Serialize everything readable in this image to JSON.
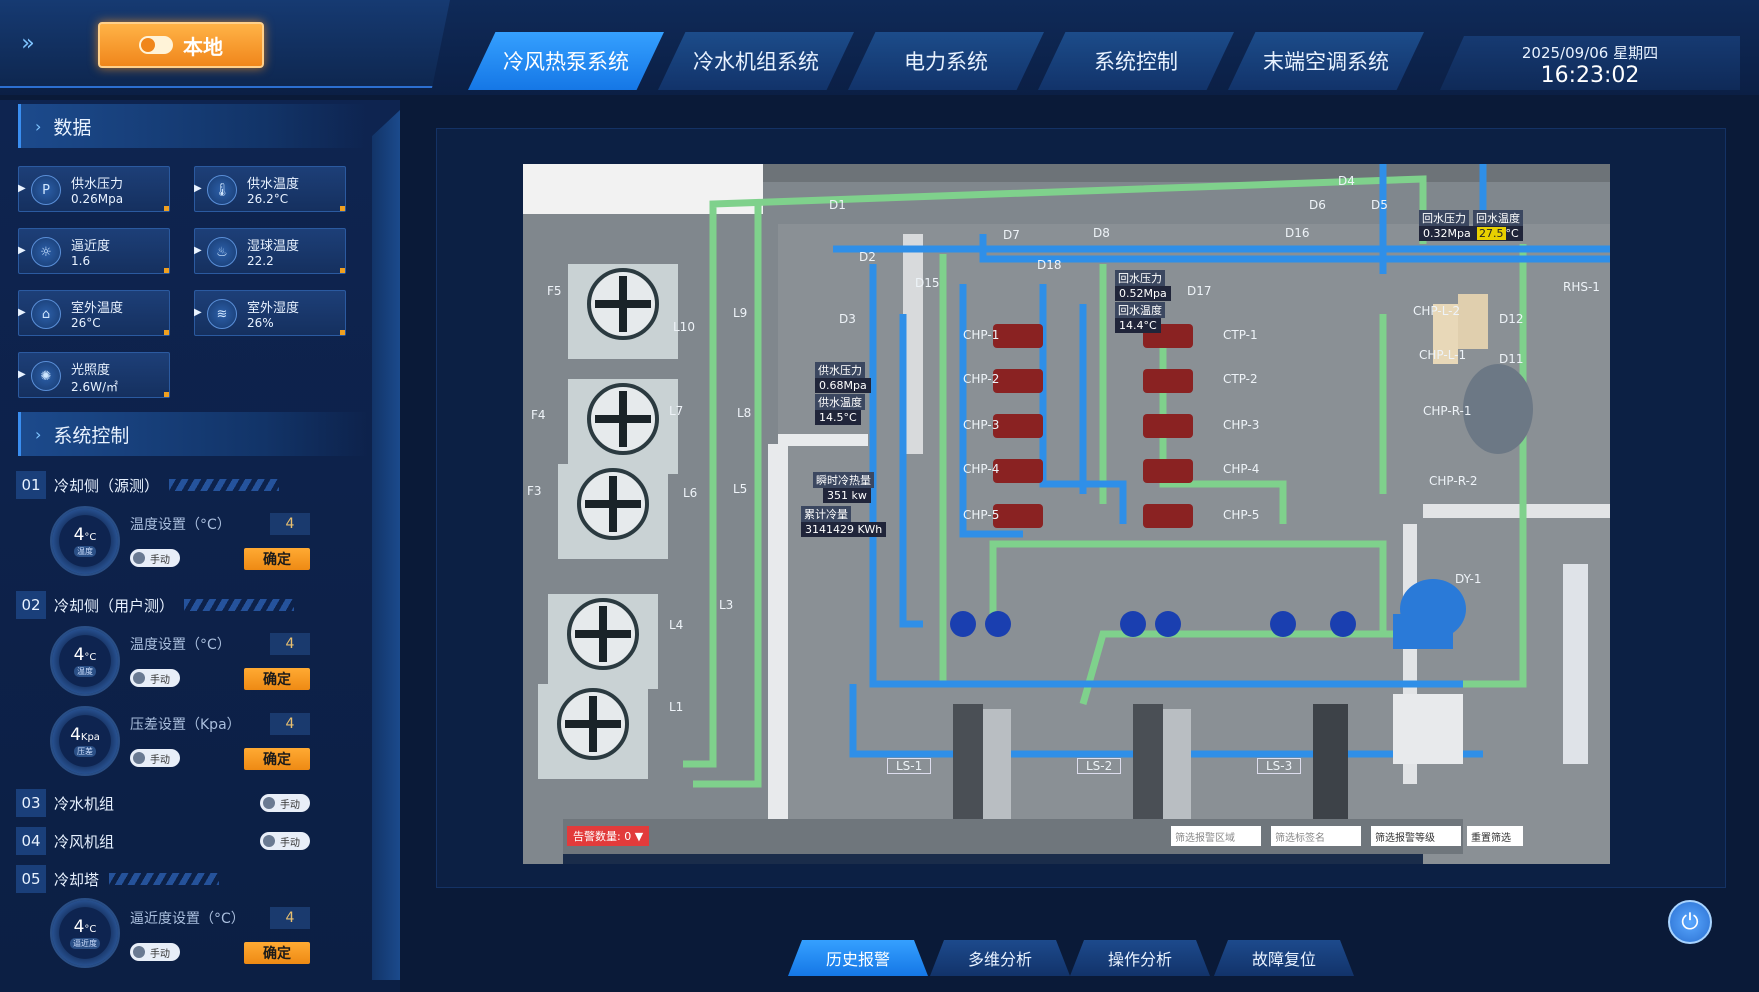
{
  "header": {
    "local_toggle_label": "本地",
    "tabs": [
      {
        "label": "冷风热泵系统",
        "active": true
      },
      {
        "label": "冷水机组系统",
        "active": false
      },
      {
        "label": "电力系统",
        "active": false
      },
      {
        "label": "系统控制",
        "active": false
      },
      {
        "label": "末端空调系统",
        "active": false
      }
    ],
    "date": "2025/09/06  星期四",
    "time": "16:23:02"
  },
  "data_section": {
    "title": "数据",
    "cards": [
      {
        "label": "供水压力",
        "value": "0.26Mpa",
        "icon": "gauge-icon"
      },
      {
        "label": "供水温度",
        "value": "26.2°C",
        "icon": "thermometer-icon"
      },
      {
        "label": "逼近度",
        "value": "1.6",
        "icon": "approach-icon"
      },
      {
        "label": "湿球温度",
        "value": "22.2",
        "icon": "wetbulb-icon"
      },
      {
        "label": "室外温度",
        "value": "26°C",
        "icon": "outdoor-temp-icon"
      },
      {
        "label": "室外湿度",
        "value": "26%",
        "icon": "humidity-icon"
      },
      {
        "label": "光照度",
        "value": "2.6W/㎡",
        "icon": "sun-icon"
      }
    ]
  },
  "control_section": {
    "title": "系统控制",
    "items": [
      {
        "num": "01",
        "name": "冷却侧（源测）",
        "gauge_value": "4",
        "gauge_unit": "°C",
        "gauge_label": "温度",
        "set_label": "温度设置（°C）",
        "set_value": "4",
        "manual": "手动",
        "confirm": "确定"
      },
      {
        "num": "02",
        "name": "冷却侧（用户测）",
        "gauge_value": "4",
        "gauge_unit": "°C",
        "gauge_label": "温度",
        "set_label": "温度设置（°C）",
        "set_value": "4",
        "manual": "手动",
        "confirm": "确定",
        "gauge2_value": "4",
        "gauge2_unit": "Kpa",
        "gauge2_label": "压差",
        "set2_label": "压差设置（Kpa）",
        "set2_value": "4",
        "manual2": "手动",
        "confirm2": "确定"
      },
      {
        "num": "03",
        "name": "冷水机组",
        "manual": "手动"
      },
      {
        "num": "04",
        "name": "冷风机组",
        "manual": "手动"
      },
      {
        "num": "05",
        "name": "冷却塔",
        "gauge_value": "4",
        "gauge_unit": "°C",
        "gauge_label": "逼近度",
        "set_label": "逼近度设置（°C）",
        "set_value": "4",
        "manual": "手动",
        "confirm": "确定"
      }
    ]
  },
  "scene": {
    "valves": [
      "D1",
      "D2",
      "D3",
      "D4",
      "D5",
      "D6",
      "D7",
      "D8",
      "D15",
      "D16",
      "D17",
      "D18",
      "D11",
      "D12"
    ],
    "fans": [
      "L1",
      "L3",
      "L4",
      "L5",
      "L6",
      "L7",
      "L8",
      "L9",
      "L10"
    ],
    "areas": [
      "F3",
      "F4",
      "F5"
    ],
    "chp_left": [
      "CHP-1",
      "CHP-2",
      "CHP-3",
      "CHP-4",
      "CHP-5"
    ],
    "ctp_right": [
      "CTP-1",
      "CTP-2",
      "CHP-3",
      "CHP-4",
      "CHP-5"
    ],
    "chillers": [
      "LS-1",
      "LS-2",
      "LS-3"
    ],
    "right_devices": [
      "RHS-1",
      "CHP-L-2",
      "CHP-L-1",
      "CHP-R-1",
      "CHP-R-2",
      "DY-1"
    ],
    "return_pressure_label": "回水压力",
    "return_pressure_value": "0.32",
    "return_pressure_unit": "Mpa",
    "return_temp_label": "回水温度",
    "return_temp_value": "27.5",
    "return_temp_unit": "°C",
    "mid_return_pressure_label": "回水压力",
    "mid_return_pressure_value": "0.52",
    "mid_return_pressure_unit": "Mpa",
    "mid_return_temp_label": "回水温度",
    "mid_return_temp_value": "14.4",
    "mid_return_temp_unit": "°C",
    "supply_pressure_label": "供水压力",
    "supply_pressure_value": "0.68",
    "supply_pressure_unit": "Mpa",
    "supply_temp_label": "供水温度",
    "supply_temp_value": "14.5",
    "supply_temp_unit": "°C",
    "instant_cooling_label": "瞬时冷热量",
    "instant_cooling_value": "351",
    "instant_cooling_unit": "kw",
    "total_cooling_label": "累计冷量",
    "total_cooling_value": "3141429",
    "total_cooling_unit": "KWh",
    "alarm_count": "告警数量: 0 ▼",
    "filter_area": "筛选报警区域",
    "filter_tag": "筛选标签名",
    "filter_level": "筛选报警等级",
    "reset_filter": "重置筛选"
  },
  "bottom": {
    "buttons": [
      {
        "label": "历史报警",
        "active": true
      },
      {
        "label": "多维分析",
        "active": false
      },
      {
        "label": "操作分析",
        "active": false
      },
      {
        "label": "故障复位",
        "active": false
      }
    ]
  },
  "colors": {
    "accent": "#1e8cf5",
    "confirm": "#f09a20",
    "panel": "#0e2450",
    "pipe_blue": "#2f8fe8",
    "pipe_green": "#7ecf8a"
  }
}
